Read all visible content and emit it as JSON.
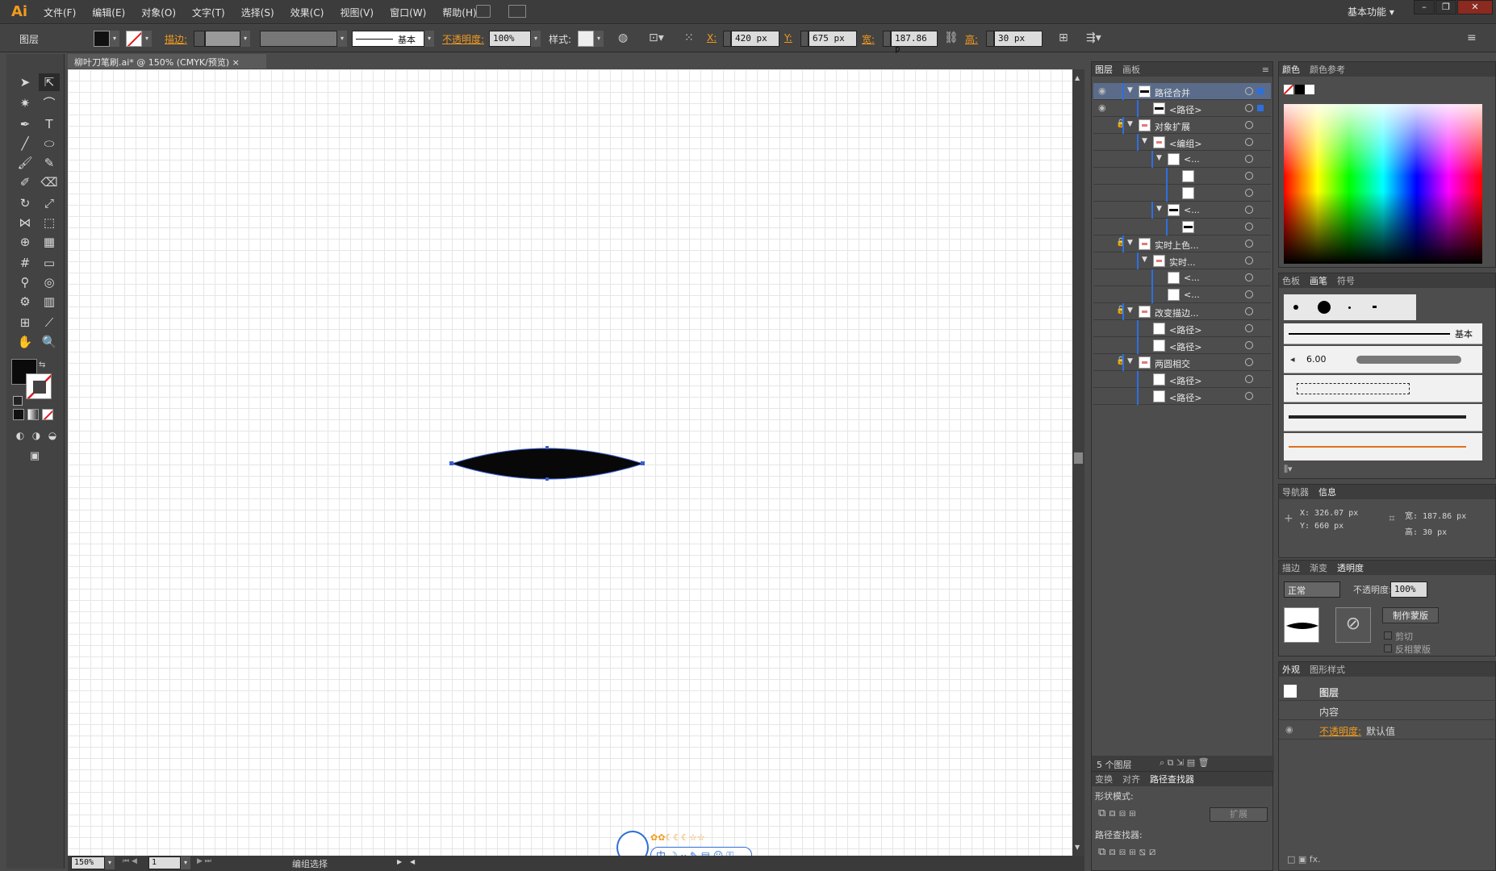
{
  "app": {
    "logo": "Ai",
    "menus": [
      "文件(F)",
      "编辑(E)",
      "对象(O)",
      "文字(T)",
      "选择(S)",
      "效果(C)",
      "视图(V)",
      "窗口(W)",
      "帮助(H)"
    ],
    "workspace": "基本功能"
  },
  "control": {
    "context": "图层",
    "stroke_label": "描边:",
    "stroke_style": "基本",
    "opacity_label": "不透明度:",
    "opacity": "100%",
    "style_label": "样式:",
    "x_label": "X:",
    "x": "420 px",
    "y_label": "Y:",
    "y": "675 px",
    "w_label": "宽:",
    "w": "187.86 p",
    "h_label": "高:",
    "h": "30 px"
  },
  "document": {
    "tab": "柳叶刀笔刷.ai* @ 150% (CMYK/预览)",
    "zoom": "150%",
    "artboard": "1",
    "status": "编组选择"
  },
  "layers": {
    "tabs": [
      "图层",
      "画板"
    ],
    "footer": "5 个图层",
    "rows": [
      {
        "name": "路径合并",
        "depth": 0,
        "open": true,
        "eye": true,
        "lock": false,
        "thumb": "bar",
        "sel": true,
        "hl": true
      },
      {
        "name": "<路径>",
        "depth": 1,
        "open": false,
        "eye": true,
        "lock": false,
        "thumb": "bar",
        "sel": true,
        "hl": false
      },
      {
        "name": "对象扩展",
        "depth": 0,
        "open": true,
        "eye": false,
        "lock": true,
        "thumb": "pink",
        "sel": false,
        "hl": false
      },
      {
        "name": "<编组>",
        "depth": 1,
        "open": true,
        "eye": false,
        "lock": false,
        "thumb": "pink",
        "sel": false,
        "hl": false
      },
      {
        "name": "<...",
        "depth": 2,
        "open": true,
        "eye": false,
        "lock": false,
        "thumb": "white",
        "sel": false,
        "hl": false
      },
      {
        "name": "",
        "depth": 3,
        "open": false,
        "eye": false,
        "lock": false,
        "thumb": "white",
        "sel": false,
        "hl": false
      },
      {
        "name": "",
        "depth": 3,
        "open": false,
        "eye": false,
        "lock": false,
        "thumb": "white",
        "sel": false,
        "hl": false
      },
      {
        "name": "<...",
        "depth": 2,
        "open": true,
        "eye": false,
        "lock": false,
        "thumb": "bar",
        "sel": false,
        "hl": false
      },
      {
        "name": "",
        "depth": 3,
        "open": false,
        "eye": false,
        "lock": false,
        "thumb": "bar",
        "sel": false,
        "hl": false
      },
      {
        "name": "实时上色...",
        "depth": 0,
        "open": true,
        "eye": false,
        "lock": true,
        "thumb": "pink",
        "sel": false,
        "hl": false
      },
      {
        "name": "实时...",
        "depth": 1,
        "open": true,
        "eye": false,
        "lock": false,
        "thumb": "pink",
        "sel": false,
        "hl": false
      },
      {
        "name": "<...",
        "depth": 2,
        "open": false,
        "eye": false,
        "lock": false,
        "thumb": "white",
        "sel": false,
        "hl": false
      },
      {
        "name": "<...",
        "depth": 2,
        "open": false,
        "eye": false,
        "lock": false,
        "thumb": "white",
        "sel": false,
        "hl": false
      },
      {
        "name": "改变描边...",
        "depth": 0,
        "open": true,
        "eye": false,
        "lock": true,
        "thumb": "pink",
        "sel": false,
        "hl": false
      },
      {
        "name": "<路径>",
        "depth": 1,
        "open": false,
        "eye": false,
        "lock": false,
        "thumb": "white",
        "sel": false,
        "hl": false
      },
      {
        "name": "<路径>",
        "depth": 1,
        "open": false,
        "eye": false,
        "lock": false,
        "thumb": "white",
        "sel": false,
        "hl": false
      },
      {
        "name": "两圆相交",
        "depth": 0,
        "open": true,
        "eye": false,
        "lock": true,
        "thumb": "pink",
        "sel": false,
        "hl": false
      },
      {
        "name": "<路径>",
        "depth": 1,
        "open": false,
        "eye": false,
        "lock": false,
        "thumb": "white",
        "sel": false,
        "hl": false
      },
      {
        "name": "<路径>",
        "depth": 1,
        "open": false,
        "eye": false,
        "lock": false,
        "thumb": "white",
        "sel": false,
        "hl": false
      }
    ]
  },
  "pathfinder": {
    "tabs": [
      "变换",
      "对齐",
      "路径查找器"
    ],
    "shape_modes": "形状模式:",
    "expand": "扩展",
    "pathfinders": "路径查找器:"
  },
  "color": {
    "tabs": [
      "颜色",
      "颜色参考"
    ]
  },
  "brushes": {
    "tabs": [
      "色板",
      "画笔",
      "符号"
    ],
    "basic": "基本",
    "size": "6.00"
  },
  "info": {
    "tabs": [
      "导航器",
      "信息"
    ],
    "x": "X: 326.07 px",
    "y": "Y: 660 px",
    "w": "宽: 187.86 px",
    "h": "高: 30 px"
  },
  "transparency": {
    "tabs": [
      "描边",
      "渐变",
      "透明度"
    ],
    "mode": "正常",
    "opacity_label": "不透明度:",
    "opacity": "100%",
    "make_mask": "制作蒙版",
    "clip": "剪切",
    "invert": "反相蒙版"
  },
  "appearance": {
    "tabs": [
      "外观",
      "图形样式"
    ],
    "layer": "图层",
    "content": "内容",
    "opacity_link": "不透明度:",
    "opacity_val": "默认值"
  },
  "ime": {
    "lang": "中"
  }
}
